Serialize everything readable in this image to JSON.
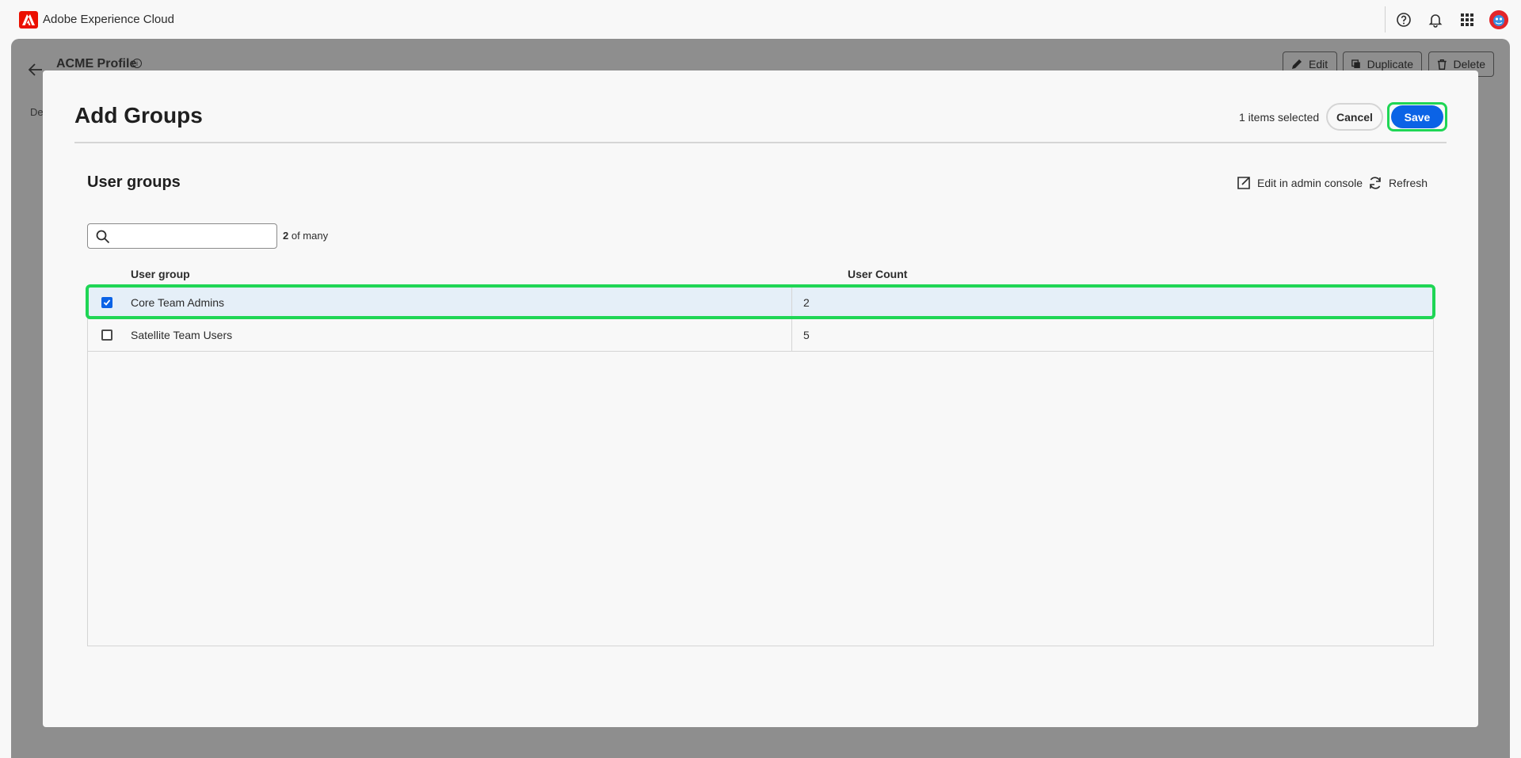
{
  "shell": {
    "app_title": "Adobe Experience Cloud",
    "icons": [
      "help-icon",
      "bell-icon",
      "apps-grid-icon"
    ],
    "brand_color": "#eb1000"
  },
  "background_page": {
    "title": "ACME Profile",
    "tab_partial": "De",
    "buttons": {
      "edit": "Edit",
      "duplicate": "Duplicate",
      "delete": "Delete"
    }
  },
  "modal": {
    "title": "Add Groups",
    "selected_text": "1 items selected",
    "cancel_label": "Cancel",
    "save_label": "Save",
    "accent_color": "#0b63e6",
    "highlight_color": "#1fd655"
  },
  "section": {
    "title": "User groups",
    "edit_admin_label": "Edit in admin console",
    "refresh_label": "Refresh"
  },
  "search": {
    "placeholder": "",
    "value": "",
    "count_number": "2",
    "count_suffix": " of many"
  },
  "table": {
    "headers": {
      "group": "User group",
      "count": "User Count"
    },
    "rows": [
      {
        "name": "Core Team Admins",
        "count": "2",
        "checked": true
      },
      {
        "name": "Satellite Team Users",
        "count": "5",
        "checked": false
      }
    ]
  }
}
